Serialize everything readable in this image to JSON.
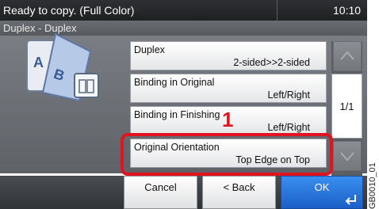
{
  "status_bar": {
    "message": "Ready to copy. (Full Color)",
    "time": "10:10"
  },
  "subtitle": "Duplex - Duplex",
  "options": [
    {
      "label": "Duplex",
      "value": "2-sided>>2-sided"
    },
    {
      "label": "Binding in Original",
      "value": "Left/Right"
    },
    {
      "label": "Binding in Finishing",
      "value": "Left/Right"
    },
    {
      "label": "Original Orientation",
      "value": "Top Edge on Top"
    }
  ],
  "pagination": {
    "indicator": "1/1"
  },
  "callout": "1",
  "buttons": {
    "cancel": "Cancel",
    "back": "< Back",
    "ok": "OK"
  },
  "figure_code": "GB0010_01",
  "colors": {
    "highlight": "#e0141e",
    "ok_button": "#2a7be0",
    "status_bar": "#26282b"
  },
  "icons": [
    "duplex-document-icon",
    "up-arrow-icon",
    "down-arrow-icon",
    "enter-icon"
  ]
}
